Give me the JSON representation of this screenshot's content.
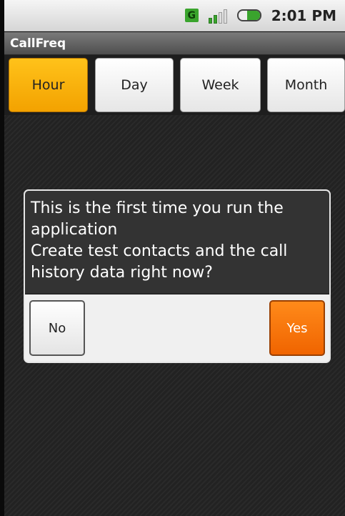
{
  "status_bar": {
    "network_badge": "G",
    "time": "2:01 PM",
    "icons": [
      "network-g-icon",
      "signal-icon",
      "battery-icon"
    ],
    "colors": {
      "network": "#3aa42d",
      "battery": "#3aa42d"
    }
  },
  "app": {
    "title": "CallFreq"
  },
  "tabs": [
    {
      "label": "Hour",
      "active": true
    },
    {
      "label": "Day",
      "active": false
    },
    {
      "label": "Week",
      "active": false
    },
    {
      "label": "Month",
      "active": false
    }
  ],
  "dialog": {
    "message_lines": [
      "This is the first time you run the",
      "application",
      "Create test contacts and the call",
      "history data right now?"
    ],
    "buttons": {
      "no": "No",
      "yes": "Yes"
    }
  },
  "colors": {
    "active_tab": "#f3a200",
    "primary_button": "#f06400"
  }
}
